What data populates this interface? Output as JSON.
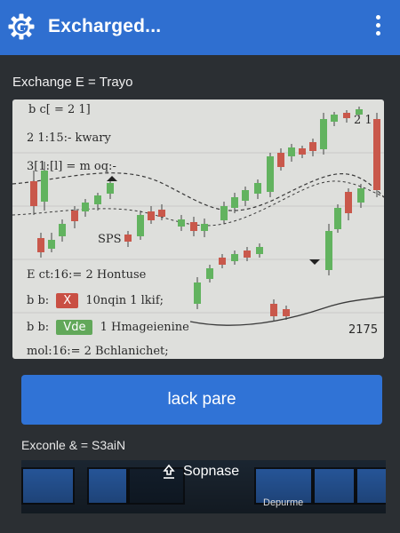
{
  "app": {
    "title": "Excharged...",
    "menu_icon": "more-vert-icon",
    "logo_icon": "gear-logo-icon"
  },
  "colors": {
    "appbar": "#2f6fd0",
    "panel": "#2b2f33",
    "button": "#3073d6",
    "candle_up": "#62b35f",
    "candle_down": "#c9584b",
    "tag_red": "#c94f43",
    "tag_green": "#62a85a"
  },
  "section": {
    "title": "Exchange E = Trayo"
  },
  "chart": {
    "annotations": [
      "b c[ = 2 1]",
      "2 1:15:- kwary",
      "3[1:[l] = m oq:-",
      "SPS",
      "2 1",
      "E ct:16:= 2 Hontuse",
      "b b:",
      "10nqin 1 lkif;",
      "b b:",
      "1 Hmageienine",
      "mol:16:= 2 Bchlanichet;",
      "2175"
    ],
    "tags": [
      "X",
      "Vde"
    ]
  },
  "action": {
    "label": "lack pare"
  },
  "subsection": {
    "title": "Exconle & = S3aiN"
  },
  "gallery": {
    "label": "Sopnase",
    "label_icon": "upload-icon",
    "caption": "Depurme"
  }
}
